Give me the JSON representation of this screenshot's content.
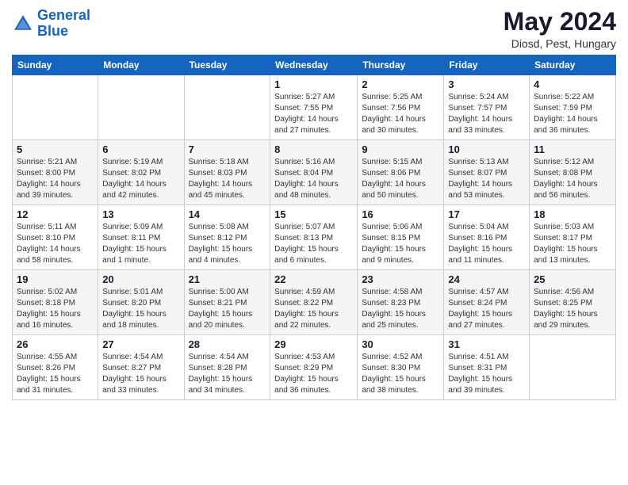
{
  "logo": {
    "line1": "General",
    "line2": "Blue"
  },
  "title": "May 2024",
  "location": "Diosd, Pest, Hungary",
  "days_header": [
    "Sunday",
    "Monday",
    "Tuesday",
    "Wednesday",
    "Thursday",
    "Friday",
    "Saturday"
  ],
  "weeks": [
    [
      {
        "day": "",
        "info": ""
      },
      {
        "day": "",
        "info": ""
      },
      {
        "day": "",
        "info": ""
      },
      {
        "day": "1",
        "info": "Sunrise: 5:27 AM\nSunset: 7:55 PM\nDaylight: 14 hours\nand 27 minutes."
      },
      {
        "day": "2",
        "info": "Sunrise: 5:25 AM\nSunset: 7:56 PM\nDaylight: 14 hours\nand 30 minutes."
      },
      {
        "day": "3",
        "info": "Sunrise: 5:24 AM\nSunset: 7:57 PM\nDaylight: 14 hours\nand 33 minutes."
      },
      {
        "day": "4",
        "info": "Sunrise: 5:22 AM\nSunset: 7:59 PM\nDaylight: 14 hours\nand 36 minutes."
      }
    ],
    [
      {
        "day": "5",
        "info": "Sunrise: 5:21 AM\nSunset: 8:00 PM\nDaylight: 14 hours\nand 39 minutes."
      },
      {
        "day": "6",
        "info": "Sunrise: 5:19 AM\nSunset: 8:02 PM\nDaylight: 14 hours\nand 42 minutes."
      },
      {
        "day": "7",
        "info": "Sunrise: 5:18 AM\nSunset: 8:03 PM\nDaylight: 14 hours\nand 45 minutes."
      },
      {
        "day": "8",
        "info": "Sunrise: 5:16 AM\nSunset: 8:04 PM\nDaylight: 14 hours\nand 48 minutes."
      },
      {
        "day": "9",
        "info": "Sunrise: 5:15 AM\nSunset: 8:06 PM\nDaylight: 14 hours\nand 50 minutes."
      },
      {
        "day": "10",
        "info": "Sunrise: 5:13 AM\nSunset: 8:07 PM\nDaylight: 14 hours\nand 53 minutes."
      },
      {
        "day": "11",
        "info": "Sunrise: 5:12 AM\nSunset: 8:08 PM\nDaylight: 14 hours\nand 56 minutes."
      }
    ],
    [
      {
        "day": "12",
        "info": "Sunrise: 5:11 AM\nSunset: 8:10 PM\nDaylight: 14 hours\nand 58 minutes."
      },
      {
        "day": "13",
        "info": "Sunrise: 5:09 AM\nSunset: 8:11 PM\nDaylight: 15 hours\nand 1 minute."
      },
      {
        "day": "14",
        "info": "Sunrise: 5:08 AM\nSunset: 8:12 PM\nDaylight: 15 hours\nand 4 minutes."
      },
      {
        "day": "15",
        "info": "Sunrise: 5:07 AM\nSunset: 8:13 PM\nDaylight: 15 hours\nand 6 minutes."
      },
      {
        "day": "16",
        "info": "Sunrise: 5:06 AM\nSunset: 8:15 PM\nDaylight: 15 hours\nand 9 minutes."
      },
      {
        "day": "17",
        "info": "Sunrise: 5:04 AM\nSunset: 8:16 PM\nDaylight: 15 hours\nand 11 minutes."
      },
      {
        "day": "18",
        "info": "Sunrise: 5:03 AM\nSunset: 8:17 PM\nDaylight: 15 hours\nand 13 minutes."
      }
    ],
    [
      {
        "day": "19",
        "info": "Sunrise: 5:02 AM\nSunset: 8:18 PM\nDaylight: 15 hours\nand 16 minutes."
      },
      {
        "day": "20",
        "info": "Sunrise: 5:01 AM\nSunset: 8:20 PM\nDaylight: 15 hours\nand 18 minutes."
      },
      {
        "day": "21",
        "info": "Sunrise: 5:00 AM\nSunset: 8:21 PM\nDaylight: 15 hours\nand 20 minutes."
      },
      {
        "day": "22",
        "info": "Sunrise: 4:59 AM\nSunset: 8:22 PM\nDaylight: 15 hours\nand 22 minutes."
      },
      {
        "day": "23",
        "info": "Sunrise: 4:58 AM\nSunset: 8:23 PM\nDaylight: 15 hours\nand 25 minutes."
      },
      {
        "day": "24",
        "info": "Sunrise: 4:57 AM\nSunset: 8:24 PM\nDaylight: 15 hours\nand 27 minutes."
      },
      {
        "day": "25",
        "info": "Sunrise: 4:56 AM\nSunset: 8:25 PM\nDaylight: 15 hours\nand 29 minutes."
      }
    ],
    [
      {
        "day": "26",
        "info": "Sunrise: 4:55 AM\nSunset: 8:26 PM\nDaylight: 15 hours\nand 31 minutes."
      },
      {
        "day": "27",
        "info": "Sunrise: 4:54 AM\nSunset: 8:27 PM\nDaylight: 15 hours\nand 33 minutes."
      },
      {
        "day": "28",
        "info": "Sunrise: 4:54 AM\nSunset: 8:28 PM\nDaylight: 15 hours\nand 34 minutes."
      },
      {
        "day": "29",
        "info": "Sunrise: 4:53 AM\nSunset: 8:29 PM\nDaylight: 15 hours\nand 36 minutes."
      },
      {
        "day": "30",
        "info": "Sunrise: 4:52 AM\nSunset: 8:30 PM\nDaylight: 15 hours\nand 38 minutes."
      },
      {
        "day": "31",
        "info": "Sunrise: 4:51 AM\nSunset: 8:31 PM\nDaylight: 15 hours\nand 39 minutes."
      },
      {
        "day": "",
        "info": ""
      }
    ]
  ]
}
